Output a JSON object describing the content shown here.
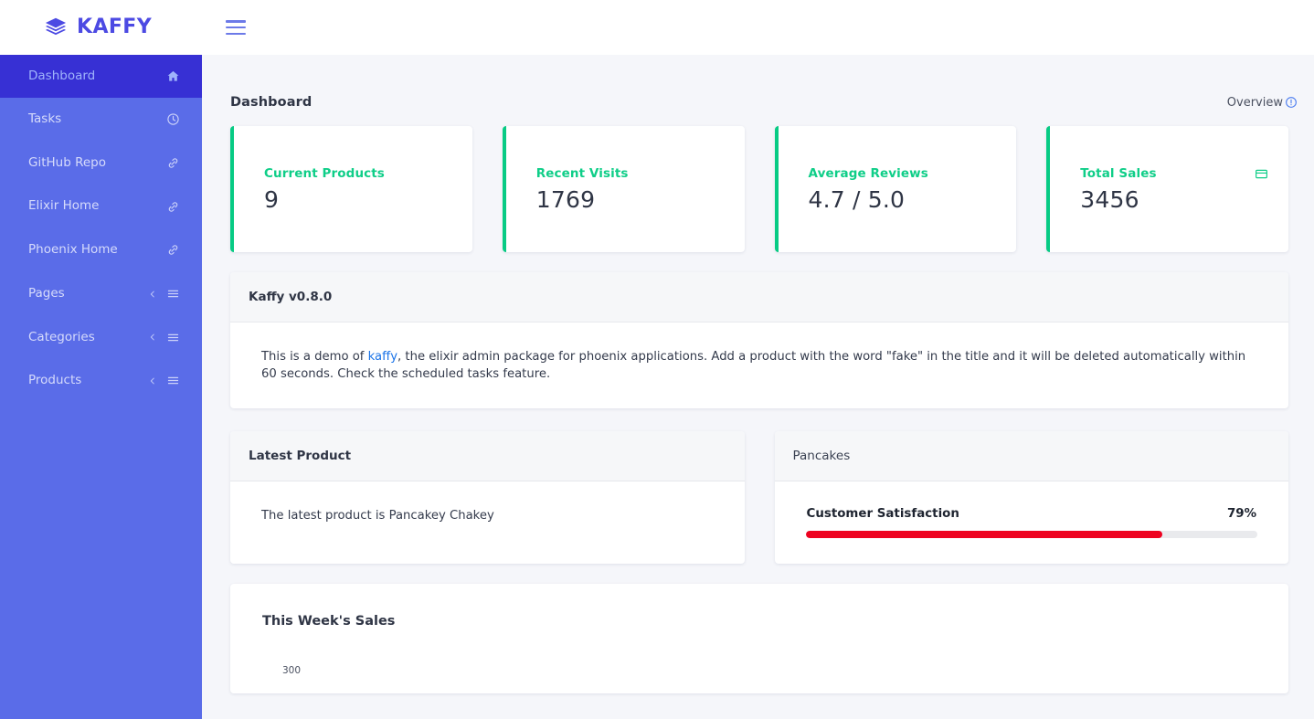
{
  "header": {
    "brand_name": "KAFFY",
    "logo_icon": "layers-icon",
    "menu_icon": "hamburger-menu-icon"
  },
  "sidebar": {
    "items": [
      {
        "label": "Dashboard",
        "icon": "home-icon",
        "active": true,
        "expandable": false
      },
      {
        "label": "Tasks",
        "icon": "clock-icon",
        "active": false,
        "expandable": false
      },
      {
        "label": "GitHub Repo",
        "icon": "link-icon",
        "active": false,
        "expandable": false
      },
      {
        "label": "Elixir Home",
        "icon": "link-icon",
        "active": false,
        "expandable": false
      },
      {
        "label": "Phoenix Home",
        "icon": "link-icon",
        "active": false,
        "expandable": false
      },
      {
        "label": "Pages",
        "icon": "list-icon",
        "active": false,
        "expandable": true
      },
      {
        "label": "Categories",
        "icon": "list-icon",
        "active": false,
        "expandable": true
      },
      {
        "label": "Products",
        "icon": "list-icon",
        "active": false,
        "expandable": true
      }
    ]
  },
  "main": {
    "page_title": "Dashboard",
    "overview_label": "Overview",
    "overview_icon": "info-circle-icon",
    "stat_cards": [
      {
        "title": "Current Products",
        "value": "9",
        "icon": null
      },
      {
        "title": "Recent Visits",
        "value": "1769",
        "icon": null
      },
      {
        "title": "Average Reviews",
        "value": "4.7 / 5.0",
        "icon": null
      },
      {
        "title": "Total Sales",
        "value": "3456",
        "icon": "credit-card-icon"
      }
    ],
    "version_panel": {
      "title": "Kaffy v0.8.0",
      "text_before_link": "This is a demo of ",
      "link_text": "kaffy",
      "text_after_link": ", the elixir admin package for phoenix applications. Add a product with the word \"fake\" in the title and it will be deleted automatically within 60 seconds. Check the scheduled tasks feature."
    },
    "latest_product_panel": {
      "title": "Latest Product",
      "body": "The latest product is Pancakey Chakey"
    },
    "pancakes_panel": {
      "title": "Pancakes",
      "metric_label": "Customer Satisfaction",
      "metric_value": "79%",
      "progress_percent": 79
    },
    "sales_panel": {
      "title": "This Week's Sales",
      "axis_tick": "300"
    }
  },
  "colors": {
    "brand": "#4c4ae3",
    "sidebar": "#5a6ce8",
    "sidebar_active": "#3730d4",
    "accent_green": "#0fce88",
    "progress_red": "#ee0220",
    "link_blue": "#1a73e8",
    "page_bg": "#f5f6fa"
  }
}
